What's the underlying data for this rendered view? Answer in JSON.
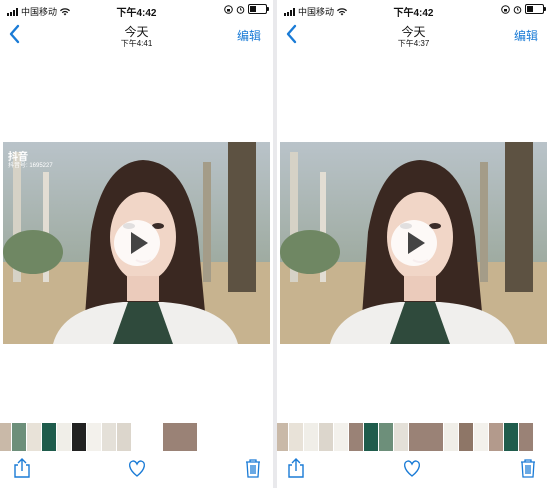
{
  "left_screen": {
    "status": {
      "carrier": "中国移动",
      "time": "下午4:42"
    },
    "nav": {
      "title": "今天",
      "subtitle": "下午4:41",
      "edit_label": "编辑"
    },
    "video_overlay": {
      "logo_text": "抖音",
      "id_text": "抖音号: 1695227"
    }
  },
  "right_screen": {
    "status": {
      "carrier": "中国移动",
      "time": "下午4:42"
    },
    "nav": {
      "title": "今天",
      "subtitle": "下午4:37",
      "edit_label": "编辑"
    }
  },
  "icons": {
    "back": "chevron-left-icon",
    "share": "share-icon",
    "favorite": "heart-icon",
    "delete": "trash-icon",
    "alarm": "alarm-icon",
    "lock": "rotation-lock-icon"
  },
  "colors": {
    "accent": "#1a7bd6"
  }
}
